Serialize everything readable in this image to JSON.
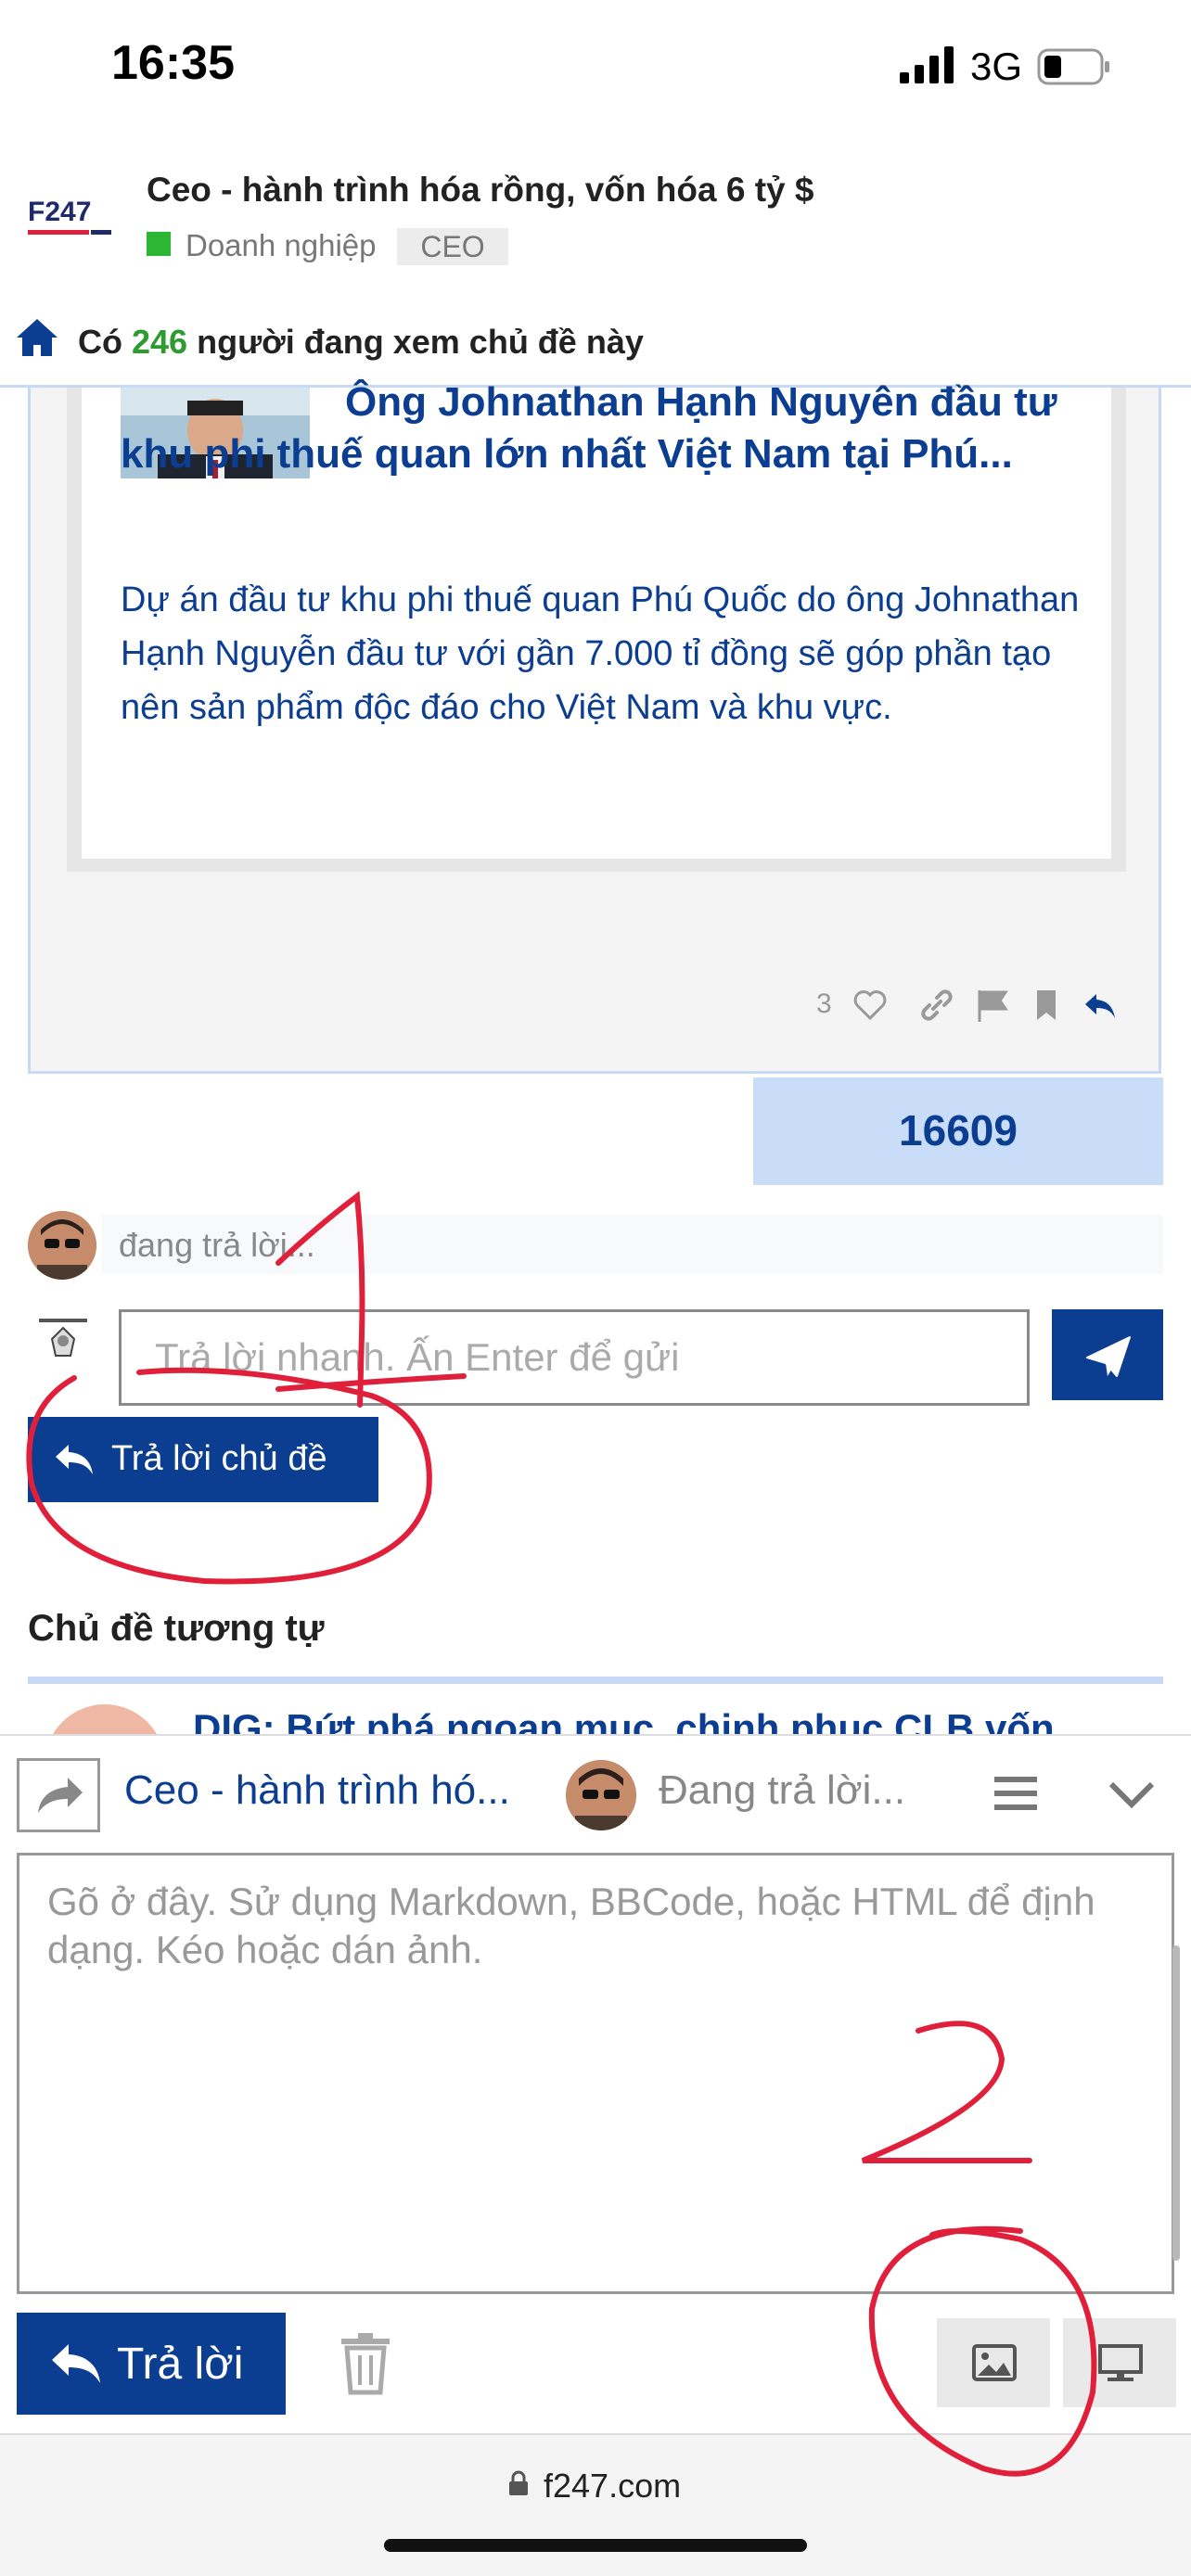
{
  "status_bar": {
    "time": "16:35",
    "network": "3G"
  },
  "header": {
    "logo_text": "F247",
    "topic_title": "Ceo - hành trình hóa rồng, vốn hóa 6 tỷ $",
    "category": "Doanh nghiệp",
    "tag": "CEO"
  },
  "viewers": {
    "prefix": "Có",
    "count": "246",
    "suffix": "người đang xem chủ đề này"
  },
  "post": {
    "onebox_title_first": "Ông Johnathan Hạnh Nguyên đầu",
    "onebox_title_rest": "tư khu phi thuế quan lớn nhất Việt Nam tại Phú...",
    "onebox_description": "Dự án đầu tư khu phi thuế quan Phú Quốc do ông Johnathan Hạnh Nguyễn đầu tư với gần 7.000 tỉ đồng sẽ góp phần tạo nên sản phẩm độc đáo cho Việt Nam và khu vực.",
    "like_count": "3",
    "post_number": "16609"
  },
  "typing": {
    "text": "đang trả lời..."
  },
  "quick_reply": {
    "placeholder": "Trả lời nhanh. Ấn Enter để gửi",
    "reply_topic_label": "Trả lời chủ đề"
  },
  "similar": {
    "heading": "Chủ đề tương tự",
    "first_title": "DIG: Bứt phá ngoạn mục, chinh phục CLB vốn"
  },
  "composer": {
    "title": "Ceo - hành trình hó...",
    "status": "Đang trả lời...",
    "placeholder": "Gõ ở đây. Sử dụng Markdown, BBCode, hoặc HTML để định dạng. Kéo hoặc dán ảnh.",
    "reply_label": "Trả lời"
  },
  "browser": {
    "url": "f247.com"
  },
  "annotations": {
    "mark_1": "1",
    "mark_2": "2"
  },
  "colors": {
    "brand_blue": "#0b3d91",
    "accent_light_blue": "#c9dcf8",
    "category_green": "#2db534",
    "annotation_red": "#e0203a"
  }
}
